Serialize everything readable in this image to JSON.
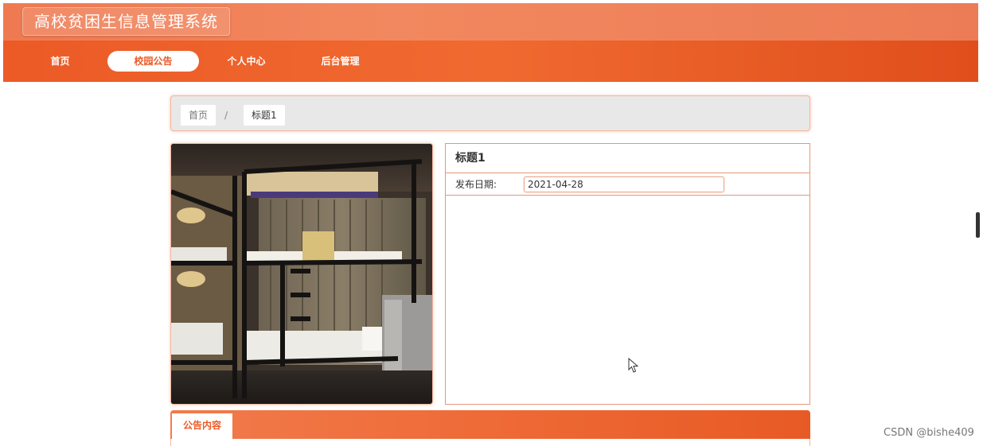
{
  "header": {
    "title": "高校贫困生信息管理系统"
  },
  "nav": {
    "items": [
      {
        "label": "首页"
      },
      {
        "label": "校园公告"
      },
      {
        "label": "个人中心"
      },
      {
        "label": "后台管理"
      }
    ],
    "active_index": 1
  },
  "breadcrumb": {
    "home": "首页",
    "separator": "/",
    "current": "标题1"
  },
  "detail": {
    "title": "标题1",
    "date_label": "发布日期:",
    "date_value": "2021-04-28"
  },
  "tabs": {
    "content_tab": "公告内容"
  },
  "watermark": "CSDN @bishe409",
  "colors": {
    "accent": "#ec5a26",
    "header": "#ef7a52",
    "border": "#e2987c"
  }
}
